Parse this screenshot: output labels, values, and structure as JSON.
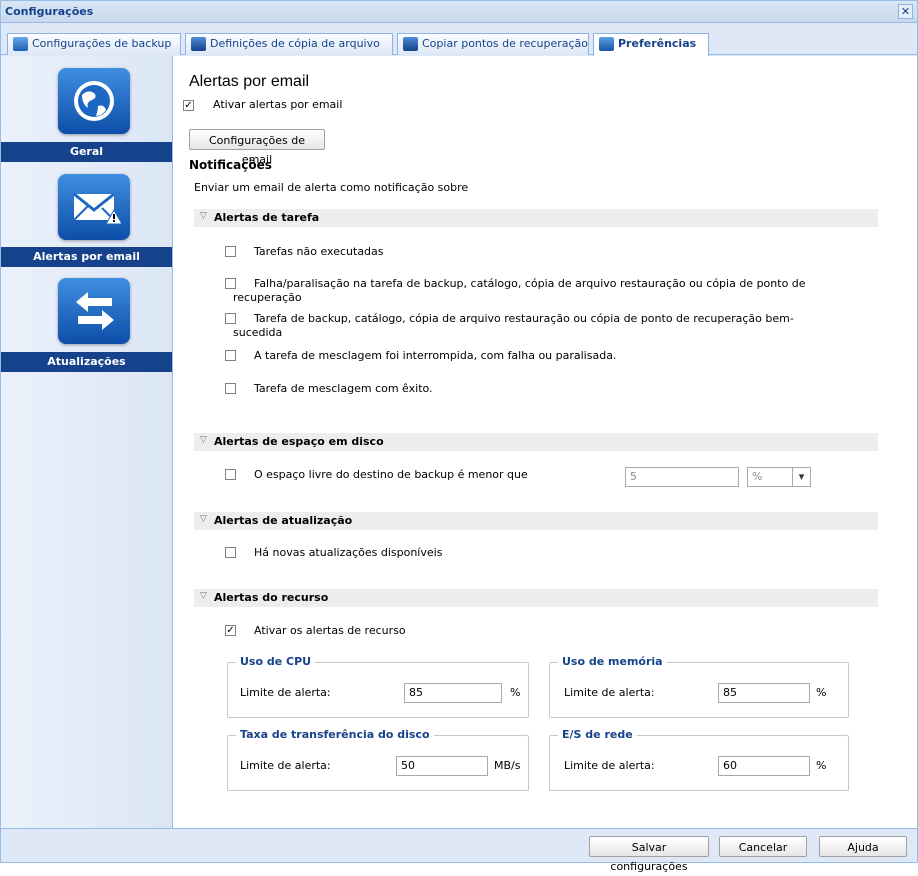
{
  "window": {
    "title": "Configurações"
  },
  "tabs": [
    {
      "label": "Configurações de backup",
      "icon": "backup-settings-icon"
    },
    {
      "label": "Definições de cópia de arquivo",
      "icon": "file-copy-icon"
    },
    {
      "label": "Copiar pontos de recuperação",
      "icon": "recovery-points-icon"
    },
    {
      "label": "Preferências",
      "icon": "preferences-icon",
      "active": true
    }
  ],
  "sidebar": {
    "items": [
      {
        "label": "Geral",
        "icon": "globe-icon"
      },
      {
        "label": "Alertas por email",
        "icon": "email-alert-icon",
        "selected": true
      },
      {
        "label": "Atualizações",
        "icon": "arrows-icon"
      }
    ]
  },
  "main": {
    "title": "Alertas por email",
    "enable_email_alerts": {
      "label": "Ativar alertas por email",
      "checked": true
    },
    "email_settings_button": "Configurações de email",
    "notifications_heading": "Notificações",
    "notifications_desc": "Enviar um email de alerta como notificação sobre",
    "sections": {
      "job": {
        "title": "Alertas de tarefa",
        "items": [
          {
            "label": "Tarefas não executadas",
            "checked": false
          },
          {
            "label": "Falha/paralisação na tarefa de backup, catálogo, cópia de arquivo restauração ou cópia de ponto de",
            "label2": "recuperação",
            "checked": false
          },
          {
            "label": "Tarefa de backup, catálogo, cópia de arquivo restauração ou cópia de ponto de recuperação bem-",
            "label2": "sucedida",
            "checked": false
          },
          {
            "label": "A tarefa de mesclagem foi interrompida, com falha ou paralisada.",
            "checked": false
          },
          {
            "label": "Tarefa de mesclagem com êxito.",
            "checked": false
          }
        ]
      },
      "disk": {
        "title": "Alertas de espaço em disco",
        "item": {
          "label": "O espaço livre do destino de backup é menor que",
          "checked": false
        },
        "value": "5",
        "unit": "%"
      },
      "update": {
        "title": "Alertas de atualização",
        "item": {
          "label": "Há novas atualizações disponíveis",
          "checked": false
        }
      },
      "resource": {
        "title": "Alertas do recurso",
        "enable": {
          "label": "Ativar os alertas de recurso",
          "checked": true
        },
        "cpu": {
          "legend": "Uso de CPU",
          "label": "Limite de alerta:",
          "value": "85",
          "unit": "%"
        },
        "memory": {
          "legend": "Uso de memória",
          "label": "Limite de alerta:",
          "value": "85",
          "unit": "%"
        },
        "disk_throughput": {
          "legend": "Taxa de transferência do disco",
          "label": "Limite de alerta:",
          "value": "50",
          "unit": "MB/s"
        },
        "network": {
          "legend": "E/S de rede",
          "label": "Limite de alerta:",
          "value": "60",
          "unit": "%"
        }
      }
    }
  },
  "footer": {
    "save": "Salvar configurações",
    "cancel": "Cancelar",
    "help": "Ajuda"
  },
  "check_mark": "✓",
  "close_glyph": "✕",
  "collapse_glyph": "▽",
  "dropdown_glyph": "▾"
}
